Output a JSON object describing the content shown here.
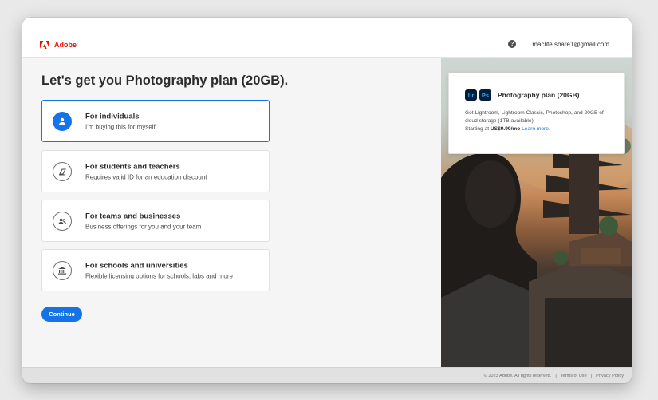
{
  "header": {
    "brand": "Adobe",
    "help_icon": "question-circle-icon",
    "email": "maclife.share1@gmail.com"
  },
  "main": {
    "heading": "Let's get you Photography plan (20GB).",
    "options": [
      {
        "title": "For individuals",
        "subtitle": "I'm buying this for myself",
        "icon": "user-icon",
        "selected": true
      },
      {
        "title": "For students and teachers",
        "subtitle": "Requires valid ID for an education discount",
        "icon": "eraser-icon",
        "selected": false
      },
      {
        "title": "For teams and businesses",
        "subtitle": "Business offerings for you and your team",
        "icon": "users-icon",
        "selected": false
      },
      {
        "title": "For schools and universities",
        "subtitle": "Flexible licensing options for schools, labs and more",
        "icon": "institution-icon",
        "selected": false
      }
    ],
    "continue_label": "Continue"
  },
  "plan": {
    "badges": [
      "Lr",
      "Ps"
    ],
    "title": "Photography plan (20GB)",
    "description": "Get Lightroom, Lightroom Classic, Photoshop, and 20GB of cloud storage (1TB available).",
    "price_prefix": "Starting at",
    "price": "US$9.99/mo",
    "learn_more": "Learn more."
  },
  "footer": {
    "copyright": "© 2023 Adobe. All rights reserved.",
    "separator": "|",
    "terms": "Terms of Use",
    "privacy": "Privacy Policy"
  },
  "colors": {
    "accent": "#1473e6",
    "brand": "#eb1000",
    "lr_badge": "#001e36"
  }
}
